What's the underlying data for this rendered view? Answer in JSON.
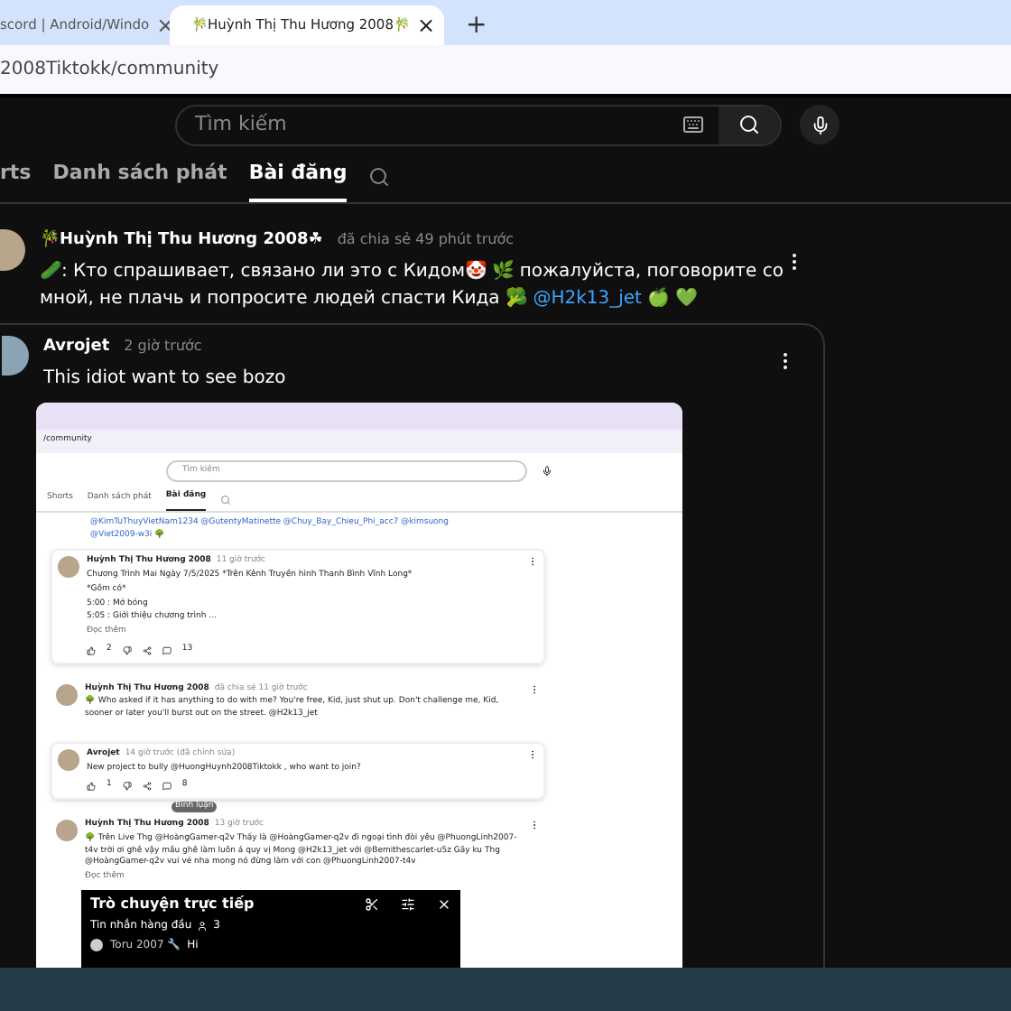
{
  "browser": {
    "tabs": [
      {
        "title": "scord | Android/Windo",
        "selected": false,
        "close": "×"
      },
      {
        "title": "🎋Huỳnh Thị Thu Hương 2008🎋",
        "selected": true,
        "close": "×"
      }
    ],
    "new_tab": "+",
    "address": "2008Tiktokk/community"
  },
  "header": {
    "search": {
      "placeholder": "Tìm kiếm"
    }
  },
  "channel_tabs": [
    {
      "label": "rts",
      "selected": false
    },
    {
      "label": "Danh sách phát",
      "selected": false
    },
    {
      "label": "Bài đăng",
      "selected": true
    }
  ],
  "post": {
    "author": "🎋Huỳnh Thị Thu Hương 2008☘",
    "time": "đã chia sẻ 49 phút trước",
    "text": "🥒: Кто спрашивает, связано ли это с Кидом🤡 🌿 пожалуйста, поговорите со мной, не плачь и попросите людей спасти Кида 🥦",
    "mention": "@H2k13_jet",
    "text_end": "🍏 💚"
  },
  "shared_post": {
    "author": "Avrojet",
    "time": "2 giờ trước",
    "text": "This idiot want to see bozo",
    "screenshot": {
      "address": "/community",
      "search": {
        "placeholder": "Tìm kiếm"
      },
      "tabs": [
        {
          "label": "Shorts",
          "selected": false
        },
        {
          "label": "Danh sách phát",
          "selected": false
        },
        {
          "label": "Bài đăng",
          "selected": true
        }
      ],
      "mentions": "@KimTuThuyVietNam1234 @GutentyMatinette @Chuy_Bay_Chieu_Phi_acc7 @kimsuong @Viet2009-w3i 🌳",
      "posts": [
        {
          "kind": "post",
          "author": "Huỳnh Thị Thu Hương 2008",
          "time": "11 giờ trước",
          "lines": [
            "Chương Trình Mai Ngày 7/5/2025 *Trên Kênh Truyền hình Thanh Bình Vĩnh Long*",
            "*Gồm có*",
            "5:00 : Mở bóng",
            "5:05 : Giới thiệu chương trình ..."
          ],
          "more": "Đọc thêm",
          "likes": "2",
          "comments": "13"
        },
        {
          "kind": "reply",
          "author": "Huỳnh Thị Thu Hương 2008",
          "time": "đã chia sẻ 11 giờ trước",
          "lines": [
            "🌳 Who asked if it has anything to do with me? You're free, Kid, just shut up. Don't challenge me, Kid, sooner or later you'll burst out on the street. @H2k13_jet"
          ]
        },
        {
          "kind": "post",
          "author": "Avrojet",
          "time": "14 giờ trước (đã chỉnh sửa)",
          "lines": [
            "New project to bully @HuongHuynh2008Tiktokk , who want to join?"
          ],
          "likes": "1",
          "comments": "8",
          "tooltip": "Bình luận"
        },
        {
          "kind": "reply",
          "author": "Huỳnh Thị Thu Hương 2008",
          "time": "13 giờ trước",
          "lines": [
            "🌳 Trên Live Thg @HoàngGamer-q2v Thấy là @HoàngGamer-q2v đi ngoại tình đòi yêu @PhuongLinh2007-t4v trời ơi ghê vậy mầu ghê làm luôn á quy vị Mong @H2k13_jet với @Bemithescarlet-u5z Gãy ku Thg @HoàngGamer-q2v vui vẻ nha mong nó đừng làm với con @PhuongLinh2007-t4v"
          ],
          "more": "Đọc thêm"
        }
      ],
      "chat": {
        "title": "Trò chuyện trực tiếp",
        "filter": "Tin nhắn hàng đầu",
        "viewers": "3",
        "messages": [
          {
            "author": "Toru 2007 🔧",
            "text": "Hi"
          }
        ]
      }
    }
  }
}
